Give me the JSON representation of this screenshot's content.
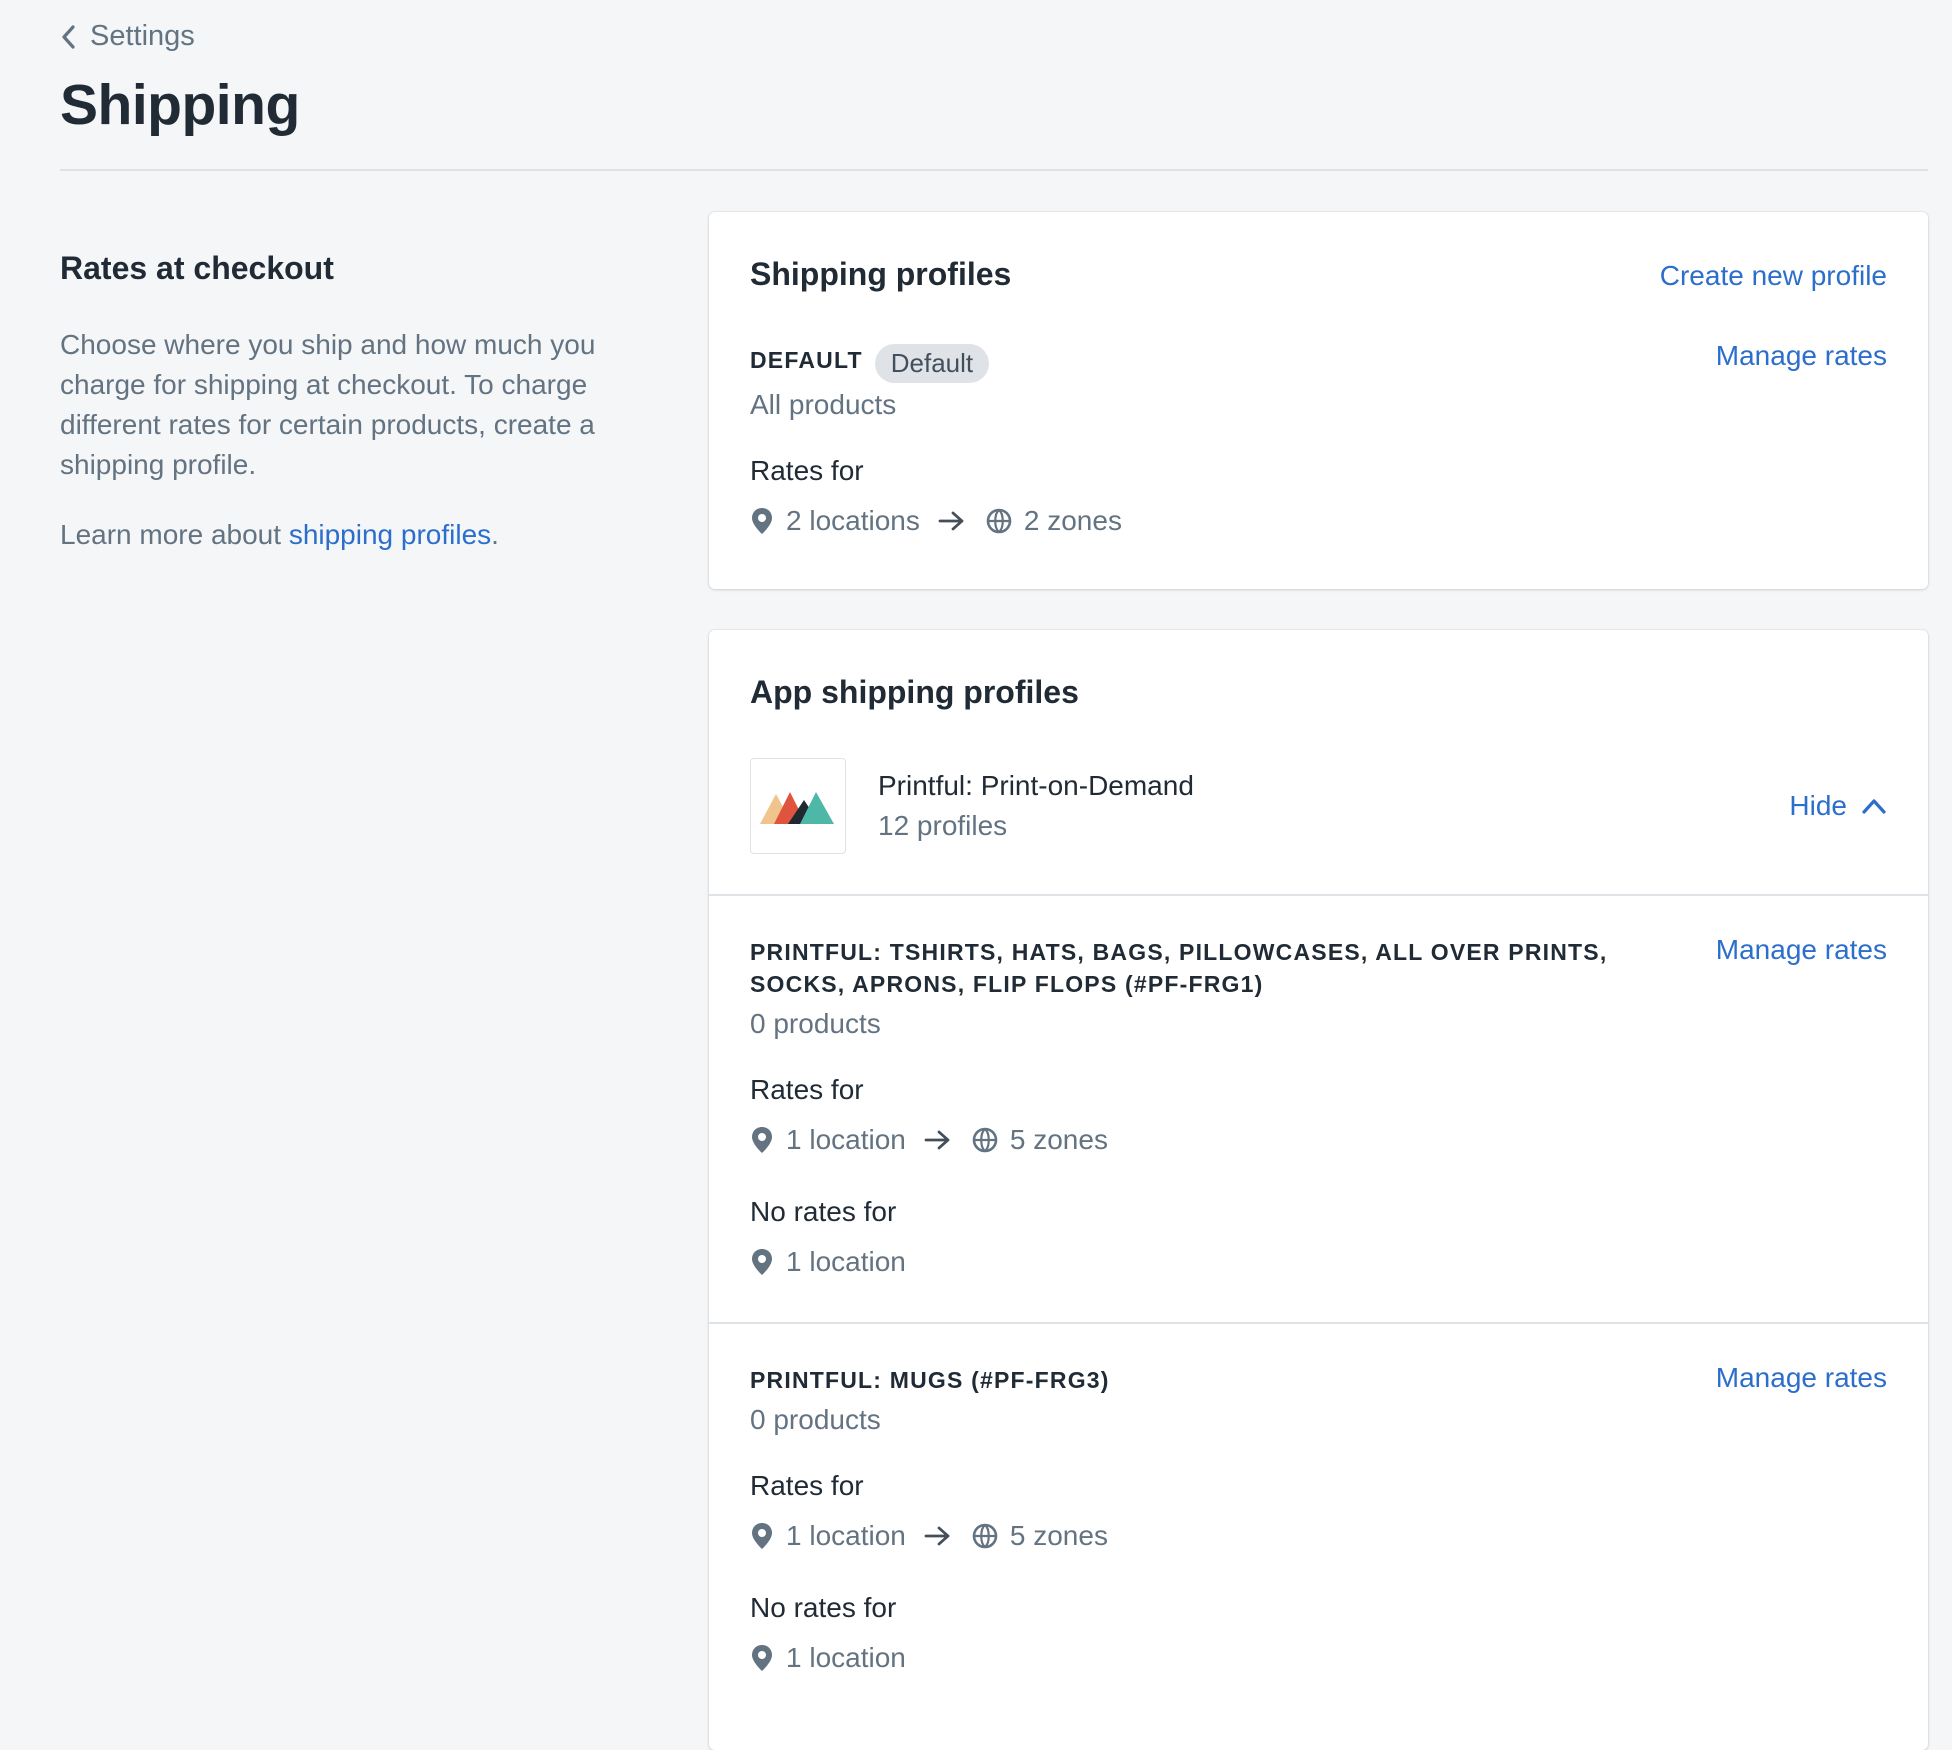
{
  "breadcrumb": {
    "label": "Settings"
  },
  "page": {
    "title": "Shipping"
  },
  "annotation": {
    "title": "Rates at checkout",
    "description": "Choose where you ship and how much you charge for shipping at checkout. To charge different rates for certain products, create a shipping profile.",
    "learn_more_prefix": "Learn more about ",
    "learn_more_link": "shipping profiles",
    "learn_more_suffix": "."
  },
  "shipping_profiles": {
    "title": "Shipping profiles",
    "create_link": "Create new profile",
    "default_profile": {
      "name": "DEFAULT",
      "badge": "Default",
      "products": "All products",
      "manage_link": "Manage rates",
      "rates_label": "Rates for",
      "locations": "2 locations",
      "zones": "2 zones"
    }
  },
  "app_profiles": {
    "title": "App shipping profiles",
    "app": {
      "name": "Printful: Print-on-Demand",
      "count": "12 profiles",
      "hide_label": "Hide"
    },
    "profiles": [
      {
        "name": "PRINTFUL: TSHIRTS, HATS, BAGS, PILLOWCASES, ALL OVER PRINTS, SOCKS, APRONS, FLIP FLOPS (#PF-FRG1)",
        "products": "0 products",
        "manage_link": "Manage rates",
        "rates_label": "Rates for",
        "locations": "1 location",
        "zones": "5 zones",
        "no_rates_label": "No rates for",
        "no_rates_locations": "1 location"
      },
      {
        "name": "PRINTFUL: MUGS (#PF-FRG3)",
        "products": "0 products",
        "manage_link": "Manage rates",
        "rates_label": "Rates for",
        "locations": "1 location",
        "zones": "5 zones",
        "no_rates_label": "No rates for",
        "no_rates_locations": "1 location"
      }
    ]
  },
  "icons": {
    "back": "chevron-left-icon",
    "location": "location-pin-icon",
    "arrow": "arrow-right-icon",
    "zone": "globe-icon",
    "collapse": "chevron-up-icon",
    "app_logo": "printful-logo"
  },
  "colors": {
    "background": "#f4f6f8",
    "link": "#2c6ecb",
    "text": "#212b36",
    "subdued": "#637381",
    "badge": "#dfe3e8"
  }
}
